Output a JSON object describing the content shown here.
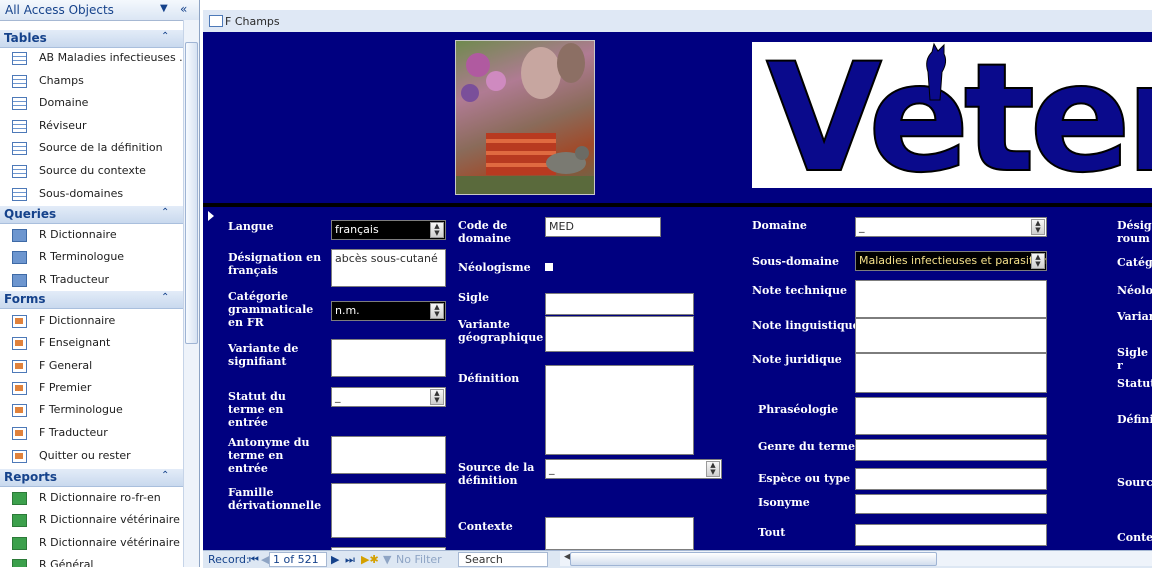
{
  "nav": {
    "title": "All Access Objects",
    "groups": {
      "tables": {
        "label": "Tables",
        "items": [
          "AB Maladies infectieuses ...",
          "Champs",
          "Domaine",
          "Réviseur",
          "Source de la définition",
          "Source du contexte",
          "Sous-domaines"
        ]
      },
      "queries": {
        "label": "Queries",
        "items": [
          "R Dictionnaire",
          "R Terminologue",
          "R Traducteur"
        ]
      },
      "forms": {
        "label": "Forms",
        "items": [
          "F Dictionnaire",
          "F Enseignant",
          "F General",
          "F Premier",
          "F Terminologue",
          "F Traducteur",
          "Quitter ou rester"
        ]
      },
      "reports": {
        "label": "Reports",
        "items": [
          "R Dictionnaire ro-fr-en",
          "R Dictionnaire vétérinaire",
          "R Dictionnaire vétérinaire ...",
          "R Général"
        ]
      }
    }
  },
  "document": {
    "tab_title": "F Champs",
    "logo_text": "Veter"
  },
  "form": {
    "col1": {
      "langue": {
        "label": "Langue",
        "value": "français"
      },
      "designation": {
        "label": "Désignation en français",
        "value": "abcès sous-cutané"
      },
      "categorie": {
        "label": "Catégorie grammaticale en FR",
        "value": "n.m."
      },
      "variante_signifiant": {
        "label": "Variante de signifiant",
        "value": ""
      },
      "statut": {
        "label": "Statut du terme en entrée",
        "value": "_"
      },
      "antonyme": {
        "label": "Antonyme du terme en entrée",
        "value": ""
      },
      "famille": {
        "label": "Famille dérivationnelle",
        "value": ""
      }
    },
    "col2": {
      "code_domaine": {
        "label": "Code de domaine",
        "value": "MED"
      },
      "neologisme": {
        "label": "Néologisme"
      },
      "sigle": {
        "label": "Sigle",
        "value": ""
      },
      "variante_geo": {
        "label": "Variante géographique",
        "value": ""
      },
      "definition": {
        "label": "Définition",
        "value": ""
      },
      "source_def": {
        "label": "Source de la définition",
        "value": "_"
      },
      "contexte": {
        "label": "Contexte",
        "value": ""
      }
    },
    "col3": {
      "domaine": {
        "label": "Domaine",
        "value": "_"
      },
      "sous_domaine": {
        "label": "Sous-domaine",
        "value": "Maladies infectieuses et parasitaires"
      },
      "note_technique": {
        "label": "Note technique"
      },
      "note_linguistique": {
        "label": "Note linguistique"
      },
      "note_juridique": {
        "label": "Note juridique"
      },
      "phraseologie": {
        "label": "Phraséologie"
      },
      "genre": {
        "label": "Genre du terme"
      },
      "espece": {
        "label": "Espèce ou type"
      },
      "isonyme": {
        "label": "Isonyme"
      },
      "tout": {
        "label": "Tout"
      }
    },
    "col4": [
      "Désign roum",
      "Catégo",
      "Néolog",
      "Varian",
      "Sigle r",
      "Statut",
      "Défini",
      "Source",
      "Conte"
    ]
  },
  "status": {
    "record_label": "Record:",
    "position": "1 of 521",
    "filter": "No Filter",
    "search": "Search"
  }
}
